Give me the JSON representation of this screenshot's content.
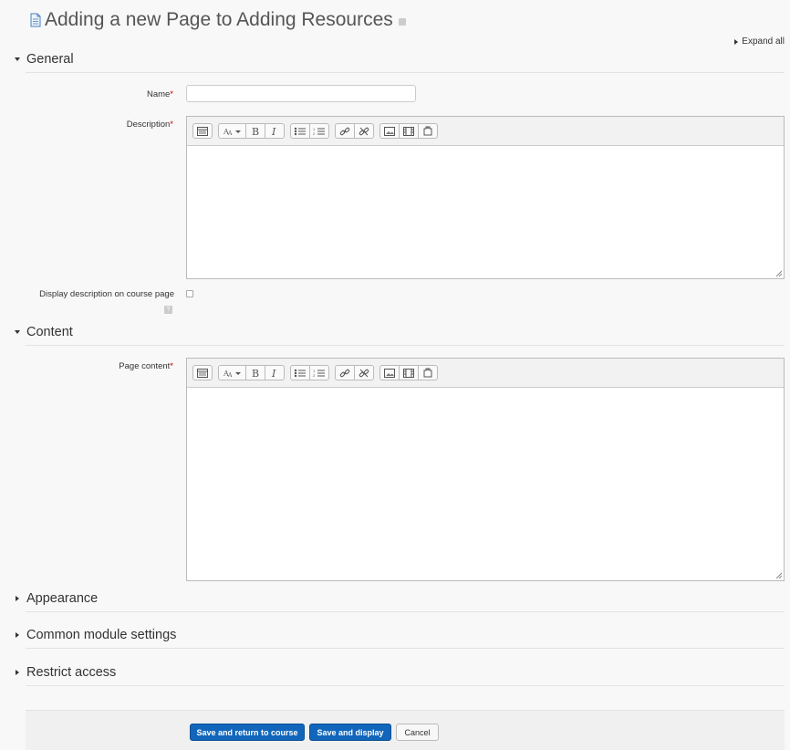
{
  "header": {
    "title": "Adding a new Page to Adding Resources",
    "expand_all": "Expand all"
  },
  "sections": {
    "general": {
      "label": "General",
      "expanded": true
    },
    "content": {
      "label": "Content",
      "expanded": true
    },
    "appearance": {
      "label": "Appearance",
      "expanded": false
    },
    "common_module": {
      "label": "Common module settings",
      "expanded": false
    },
    "restrict_access": {
      "label": "Restrict access",
      "expanded": false
    }
  },
  "fields": {
    "name_label": "Name",
    "description_label": "Description",
    "display_description_label": "Display description on course page",
    "page_content_label": "Page content",
    "required_marker": "*",
    "name_value": "",
    "display_description_checked": false
  },
  "toolbar_icons": [
    "toolbar-toggle-icon",
    "font-style-icon",
    "bold-icon",
    "italic-icon",
    "unordered-list-icon",
    "ordered-list-icon",
    "link-icon",
    "unlink-icon",
    "image-icon",
    "media-icon",
    "manage-files-icon"
  ],
  "buttons": {
    "save_return": "Save and return to course",
    "save_display": "Save and display",
    "cancel": "Cancel"
  },
  "colors": {
    "primary": "#1166bb",
    "required": "#cc0000",
    "background": "#f8f8f8"
  }
}
